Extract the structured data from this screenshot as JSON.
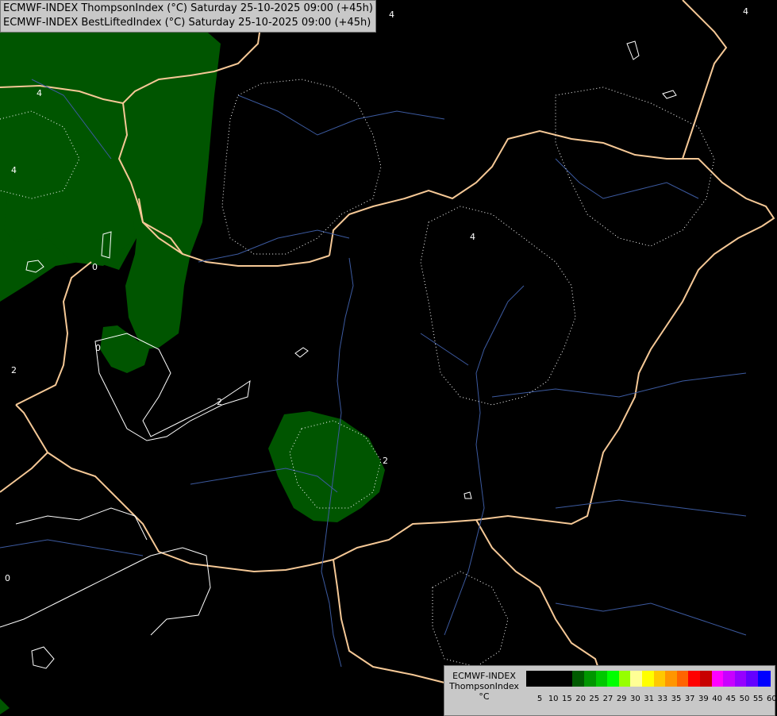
{
  "header": {
    "line1": "ECMWF-INDEX ThompsonIndex (°C) Saturday 25-10-2025 09:00 (+45h)",
    "line2": "ECMWF-INDEX BestLiftedIndex (°C) Saturday 25-10-2025 09:00 (+45h)"
  },
  "legend": {
    "line1": "ECMWF-INDEX",
    "line2": "ThompsonIndex",
    "line3": "°C",
    "ticks": [
      "5",
      "10",
      "15",
      "20",
      "25",
      "27",
      "29",
      "30",
      "31",
      "33",
      "35",
      "37",
      "39",
      "40",
      "45",
      "50",
      "55",
      "60"
    ],
    "colors": [
      "#000000",
      "#000000",
      "#000000",
      "#000000",
      "#005a00",
      "#009600",
      "#00c800",
      "#00ff00",
      "#96ff00",
      "#ffff96",
      "#ffff00",
      "#ffc800",
      "#ff9600",
      "#ff6400",
      "#ff0000",
      "#c80000",
      "#ff00ff",
      "#c800ff",
      "#9600ff",
      "#6400ff",
      "#0000ff"
    ]
  },
  "map": {
    "fill_color": "#005500",
    "border_color": "#f5c896",
    "river_color": "#3c5aa0",
    "contour_color": "#ffffff",
    "contour_labels": [
      "4",
      "4",
      "4",
      "4",
      "2",
      "2",
      "0",
      "0",
      "2",
      "0",
      "4"
    ]
  }
}
